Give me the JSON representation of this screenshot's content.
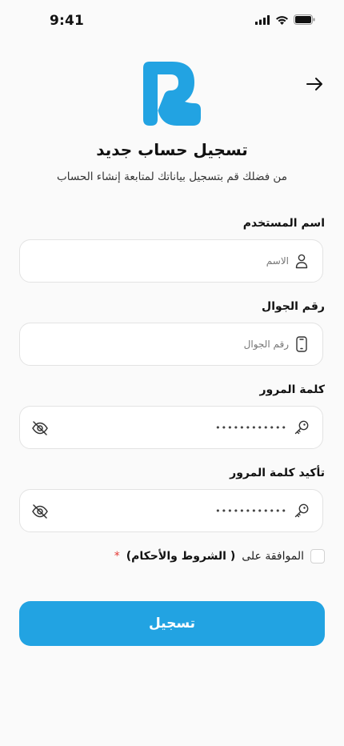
{
  "status_bar": {
    "time": "9:41"
  },
  "header": {
    "title": "تسجيل حساب جديد",
    "subtitle": "من فضلك قم بتسجيل بياناتك لمتابعة إنشاء الحساب"
  },
  "form": {
    "username": {
      "label": "اسم المستخدم",
      "placeholder": "الاسم",
      "icon": "user-icon"
    },
    "phone": {
      "label": "رقم الجوال",
      "placeholder": "رقم الجوال",
      "icon": "phone-icon"
    },
    "password": {
      "label": "كلمة المرور",
      "value": "••••••••••••",
      "icon": "key-icon",
      "toggle_icon": "eye-off-icon"
    },
    "confirm_password": {
      "label": "تأكيد كلمة المرور",
      "value": "••••••••••••",
      "icon": "key-icon",
      "toggle_icon": "eye-off-icon"
    },
    "terms": {
      "text": "الموافقة على",
      "link": "( الشروط والأحكام)",
      "required_mark": "*"
    },
    "submit_label": "تسجيل"
  },
  "colors": {
    "accent": "#22a3e2",
    "required": "#e53935",
    "border": "#e3e3e3",
    "background": "#fafafa"
  }
}
